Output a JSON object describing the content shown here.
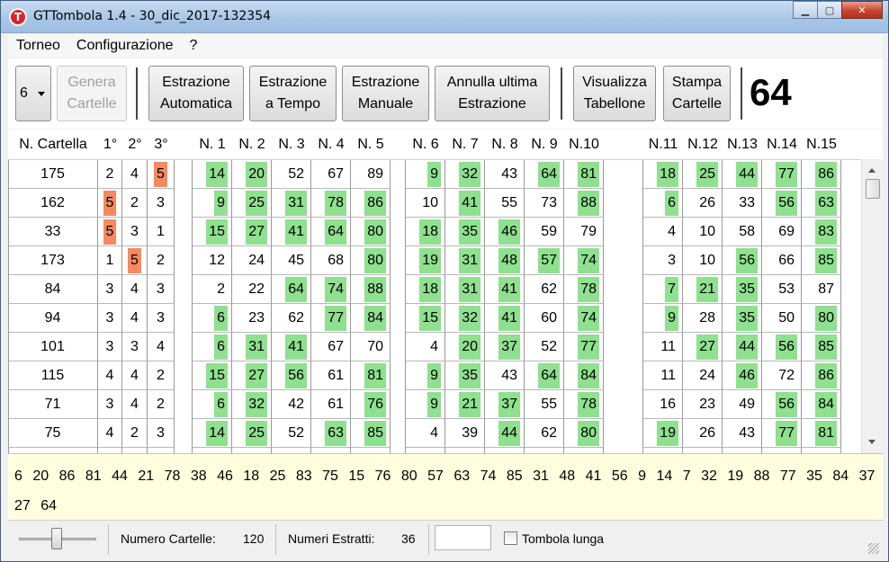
{
  "window": {
    "title": "GTTombola 1.4 - 30_dic_2017-132354",
    "icon_letter": "T"
  },
  "titlebar_buttons": {
    "minimize": "▁",
    "maximize": "▢",
    "close": "✕"
  },
  "menu": [
    "Torneo",
    "Configurazione",
    "?"
  ],
  "toolbar": {
    "combo_value": "6",
    "buttons": [
      {
        "line1": "Genera",
        "line2": "Cartelle",
        "enabled": false
      },
      {
        "line1": "Estrazione",
        "line2": "Automatica",
        "enabled": true
      },
      {
        "line1": "Estrazione",
        "line2": "a Tempo",
        "enabled": true
      },
      {
        "line1": "Estrazione",
        "line2": "Manuale",
        "enabled": true
      },
      {
        "line1": "Annulla ultima",
        "line2": "Estrazione",
        "enabled": true
      },
      {
        "line1": "Visualizza",
        "line2": "Tabellone",
        "enabled": true
      },
      {
        "line1": "Stampa",
        "line2": "Cartelle",
        "enabled": true
      }
    ],
    "last_number": "64"
  },
  "grid": {
    "headers": [
      "N. Cartella",
      "1°",
      "2°",
      "3°",
      "N. 1",
      "N. 2",
      "N. 3",
      "N. 4",
      "N. 5",
      "N. 6",
      "N. 7",
      "N. 8",
      "N. 9",
      "N.10",
      "N.11",
      "N.12",
      "N.13",
      "N.14",
      "N.15"
    ],
    "rows": [
      {
        "card": "175",
        "p": [
          "2",
          "4",
          "5"
        ],
        "pflag": [
          0,
          0,
          1
        ],
        "n": [
          "14",
          "20",
          "52",
          "67",
          "89",
          "9",
          "32",
          "43",
          "64",
          "81",
          "18",
          "25",
          "44",
          "77",
          "86"
        ],
        "g": [
          1,
          1,
          0,
          0,
          0,
          1,
          1,
          0,
          1,
          1,
          1,
          1,
          1,
          1,
          1
        ]
      },
      {
        "card": "162",
        "p": [
          "5",
          "2",
          "3"
        ],
        "pflag": [
          1,
          0,
          0
        ],
        "n": [
          "9",
          "25",
          "31",
          "78",
          "86",
          "10",
          "41",
          "55",
          "73",
          "88",
          "6",
          "26",
          "33",
          "56",
          "63"
        ],
        "g": [
          1,
          1,
          1,
          1,
          1,
          0,
          1,
          0,
          0,
          1,
          1,
          0,
          0,
          1,
          1
        ]
      },
      {
        "card": "33",
        "p": [
          "5",
          "3",
          "1"
        ],
        "pflag": [
          1,
          0,
          0
        ],
        "n": [
          "15",
          "27",
          "41",
          "64",
          "80",
          "18",
          "35",
          "46",
          "59",
          "79",
          "4",
          "10",
          "58",
          "69",
          "83"
        ],
        "g": [
          1,
          1,
          1,
          1,
          1,
          1,
          1,
          1,
          0,
          0,
          0,
          0,
          0,
          0,
          1
        ]
      },
      {
        "card": "173",
        "p": [
          "1",
          "5",
          "2"
        ],
        "pflag": [
          0,
          1,
          0
        ],
        "n": [
          "12",
          "24",
          "45",
          "68",
          "80",
          "19",
          "31",
          "48",
          "57",
          "74",
          "3",
          "10",
          "56",
          "66",
          "85"
        ],
        "g": [
          0,
          0,
          0,
          0,
          1,
          1,
          1,
          1,
          1,
          1,
          0,
          0,
          1,
          0,
          1
        ]
      },
      {
        "card": "84",
        "p": [
          "3",
          "4",
          "3"
        ],
        "pflag": [
          0,
          0,
          0
        ],
        "n": [
          "2",
          "22",
          "64",
          "74",
          "88",
          "18",
          "31",
          "41",
          "62",
          "78",
          "7",
          "21",
          "35",
          "53",
          "87"
        ],
        "g": [
          0,
          0,
          1,
          1,
          1,
          1,
          1,
          1,
          0,
          1,
          1,
          1,
          1,
          0,
          0
        ]
      },
      {
        "card": "94",
        "p": [
          "3",
          "4",
          "3"
        ],
        "pflag": [
          0,
          0,
          0
        ],
        "n": [
          "6",
          "23",
          "62",
          "77",
          "84",
          "15",
          "32",
          "41",
          "60",
          "74",
          "9",
          "28",
          "35",
          "50",
          "80"
        ],
        "g": [
          1,
          0,
          0,
          1,
          1,
          1,
          1,
          1,
          0,
          1,
          1,
          0,
          1,
          0,
          1
        ]
      },
      {
        "card": "101",
        "p": [
          "3",
          "3",
          "4"
        ],
        "pflag": [
          0,
          0,
          0
        ],
        "n": [
          "6",
          "31",
          "41",
          "67",
          "70",
          "4",
          "20",
          "37",
          "52",
          "77",
          "11",
          "27",
          "44",
          "56",
          "85"
        ],
        "g": [
          1,
          1,
          1,
          0,
          0,
          0,
          1,
          1,
          0,
          1,
          0,
          1,
          1,
          1,
          1
        ]
      },
      {
        "card": "115",
        "p": [
          "4",
          "4",
          "2"
        ],
        "pflag": [
          0,
          0,
          0
        ],
        "n": [
          "15",
          "27",
          "56",
          "61",
          "81",
          "9",
          "35",
          "43",
          "64",
          "84",
          "11",
          "24",
          "46",
          "72",
          "86"
        ],
        "g": [
          1,
          1,
          1,
          0,
          1,
          1,
          1,
          0,
          1,
          1,
          0,
          0,
          1,
          0,
          1
        ]
      },
      {
        "card": "71",
        "p": [
          "3",
          "4",
          "2"
        ],
        "pflag": [
          0,
          0,
          0
        ],
        "n": [
          "6",
          "32",
          "42",
          "61",
          "76",
          "9",
          "21",
          "37",
          "55",
          "78",
          "16",
          "23",
          "49",
          "56",
          "84"
        ],
        "g": [
          1,
          1,
          0,
          0,
          1,
          1,
          1,
          1,
          0,
          1,
          0,
          0,
          0,
          1,
          1
        ]
      },
      {
        "card": "75",
        "p": [
          "4",
          "2",
          "3"
        ],
        "pflag": [
          0,
          0,
          0
        ],
        "n": [
          "14",
          "25",
          "52",
          "63",
          "85",
          "4",
          "39",
          "44",
          "62",
          "80",
          "19",
          "26",
          "43",
          "77",
          "81"
        ],
        "g": [
          1,
          1,
          0,
          1,
          1,
          0,
          0,
          1,
          0,
          1,
          1,
          0,
          0,
          1,
          1
        ]
      }
    ]
  },
  "drawn_numbers": [
    "6",
    "20",
    "86",
    "81",
    "44",
    "21",
    "78",
    "38",
    "46",
    "18",
    "25",
    "83",
    "75",
    "15",
    "76",
    "80",
    "57",
    "63",
    "74",
    "85",
    "31",
    "48",
    "41",
    "56",
    "9",
    "14",
    "7",
    "32",
    "19",
    "88",
    "77",
    "35",
    "84",
    "37",
    "27",
    "64"
  ],
  "status": {
    "numero_cartelle_label": "Numero Cartelle:",
    "numero_cartelle_value": "120",
    "numeri_estratti_label": "Numeri Estratti:",
    "numeri_estratti_value": "36",
    "input_value": "",
    "checkbox_label": "Tombola lunga",
    "checkbox_checked": false
  },
  "colors": {
    "drawn_green": "#8fe08f",
    "row_complete_orange": "#f58a5f"
  }
}
